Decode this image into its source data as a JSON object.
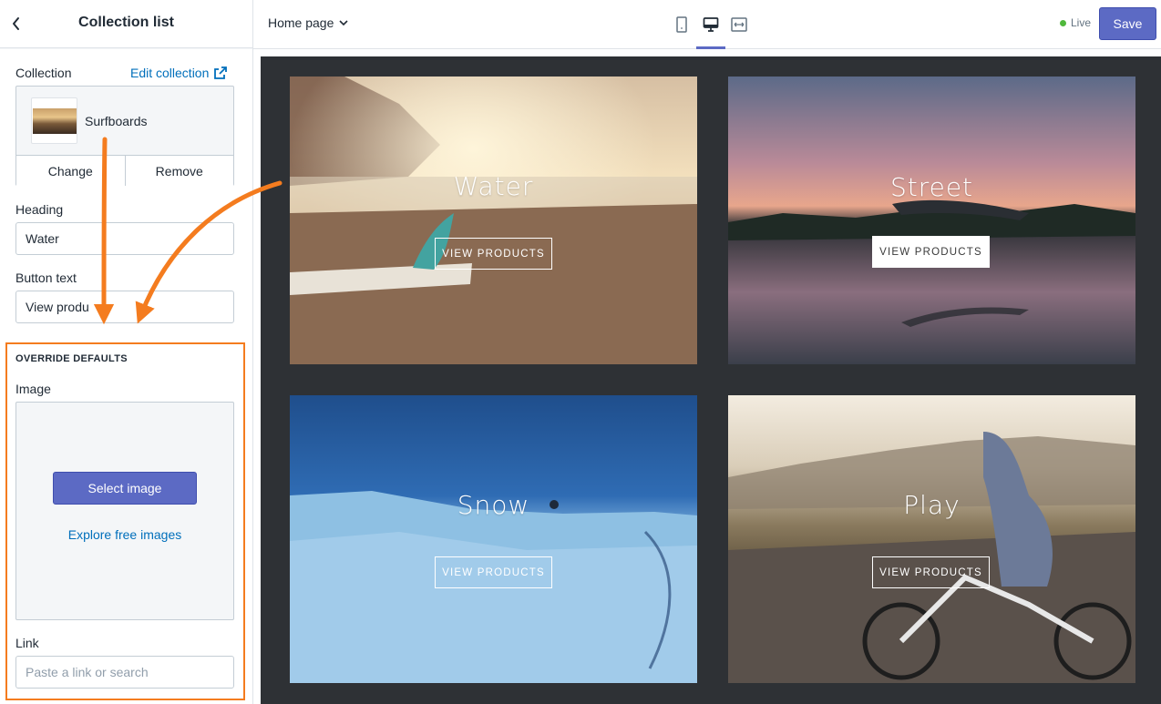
{
  "sidebar": {
    "title": "Collection list",
    "collection_label": "Collection",
    "edit_collection_link": "Edit collection",
    "collection_name": "Surfboards",
    "change_button": "Change",
    "remove_button": "Remove",
    "heading_label": "Heading",
    "heading_value": "Water",
    "button_text_label": "Button text",
    "button_text_value": "View produ",
    "override_title": "OVERRIDE DEFAULTS",
    "image_label": "Image",
    "select_image_button": "Select image",
    "explore_link": "Explore free images",
    "link_label": "Link",
    "link_placeholder": "Paste a link or search"
  },
  "topbar": {
    "page_selector": "Home page",
    "views": [
      "mobile-icon",
      "desktop-icon",
      "fullscreen-icon"
    ],
    "active_view": "desktop",
    "live_label": "Live",
    "save_button": "Save"
  },
  "preview": {
    "tiles": [
      {
        "heading": "Water",
        "button": "VIEW PRODUCTS",
        "button_style": "outline"
      },
      {
        "heading": "Street",
        "button": "VIEW PRODUCTS",
        "button_style": "solid"
      },
      {
        "heading": "Snow",
        "button": "VIEW PRODUCTS",
        "button_style": "outline"
      },
      {
        "heading": "Play",
        "button": "VIEW PRODUCTS",
        "button_style": "outline"
      }
    ]
  },
  "colors": {
    "accent": "#5c6ac4",
    "link": "#006fbb",
    "annotation": "#f47c1f",
    "live_dot": "#50b83c",
    "preview_bg": "#2e3135"
  }
}
